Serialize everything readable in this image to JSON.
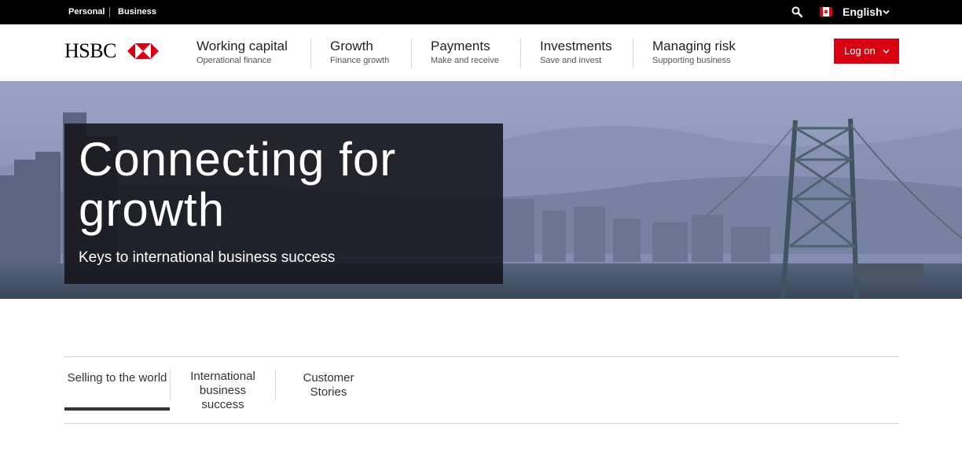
{
  "topbar": {
    "personal_label": "Personal",
    "business_label": "Business",
    "search_icon": "search-icon",
    "flag_icon": "canada-flag-icon",
    "language_label": "English"
  },
  "header": {
    "logo_text": "HSBC",
    "nav": [
      {
        "title": "Working capital",
        "sub": "Operational finance"
      },
      {
        "title": "Growth",
        "sub": "Finance growth"
      },
      {
        "title": "Payments",
        "sub": "Make and receive"
      },
      {
        "title": "Investments",
        "sub": "Save and invest"
      },
      {
        "title": "Managing risk",
        "sub": "Supporting business"
      }
    ],
    "logon_label": "Log on"
  },
  "hero": {
    "title": "Connecting for growth",
    "subtitle": "Keys to international business success"
  },
  "tabs": [
    {
      "label": "Selling to the world",
      "active": true
    },
    {
      "label": "International business success",
      "active": false
    },
    {
      "label": "Customer Stories",
      "active": false
    }
  ],
  "colors": {
    "brand_red": "#db0011",
    "topbar_bg": "#000000",
    "hero_box": "#141419"
  }
}
